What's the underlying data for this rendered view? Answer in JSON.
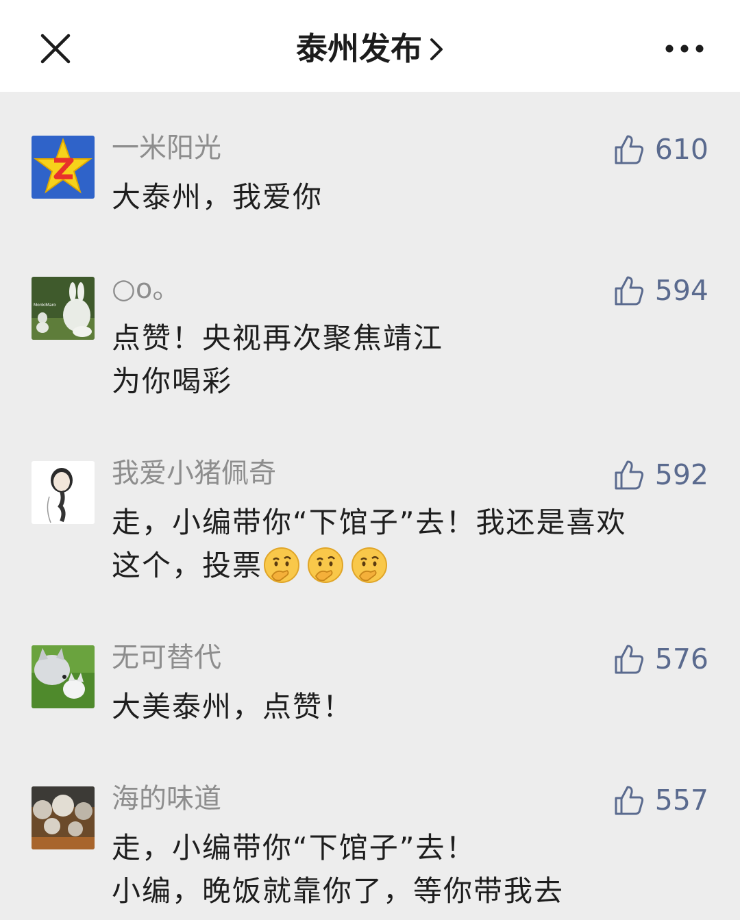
{
  "header": {
    "title": "泰州发布",
    "chevron_icon": "chevron-right-icon",
    "close_icon": "close-icon",
    "more_icon": "more-dots-icon"
  },
  "comments": [
    {
      "username": "一米阳光",
      "likes": "610",
      "avatar": "star-z-avatar",
      "lines": [
        "大泰州，我爱你"
      ]
    },
    {
      "username": "○o。",
      "likes": "594",
      "avatar": "rabbit-avatar",
      "avatar_text": "MonkiMaro",
      "lines": [
        "点赞！央视再次聚焦靖江",
        "为你喝彩"
      ]
    },
    {
      "username": "我爱小猪佩奇",
      "likes": "592",
      "avatar": "braid-girl-avatar",
      "lines": [
        "走，小编带你“下馆子”去！我还是喜欢",
        "这个，投票"
      ],
      "emojis": [
        "thinking-face-emoji",
        "thinking-face-emoji",
        "thinking-face-emoji"
      ]
    },
    {
      "username": "无可替代",
      "likes": "576",
      "avatar": "husky-puppy-avatar",
      "lines": [
        "大美泰州，点赞！"
      ]
    },
    {
      "username": "海的味道",
      "likes": "557",
      "avatar": "coral-avatar",
      "lines": [
        "走，小编带你“下馆子”去！",
        "小编，晚饭就靠你了，等你带我去"
      ]
    }
  ],
  "colors": {
    "background": "#ededed",
    "navbar": "#ffffff",
    "username": "#8d8d8d",
    "like_count": "#5a6a8e",
    "text": "#1e1e1e"
  }
}
